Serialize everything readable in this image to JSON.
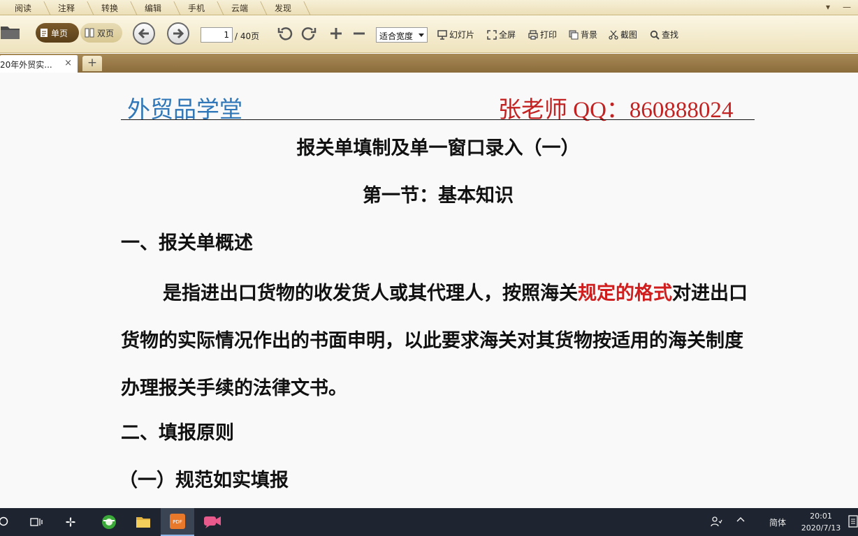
{
  "menu": {
    "tabs": [
      "阅读",
      "注释",
      "转换",
      "编辑",
      "手机",
      "云端",
      "发现"
    ]
  },
  "toolbar": {
    "single_page": "单页",
    "double_page": "双页",
    "current_page": "1",
    "total_pages": "/ 40页",
    "zoom_mode": "适合宽度",
    "slideshow": "幻灯片",
    "fullscreen": "全屏",
    "print": "打印",
    "background": "背景",
    "screenshot": "截图",
    "find": "查找"
  },
  "tabs": {
    "doc_tab": "20年外贸实...",
    "close": "×",
    "new_tab": "+"
  },
  "document": {
    "header_left": "外贸品学堂",
    "header_right": "张老师 QQ：860888024",
    "title": "报关单填制及单一窗口录入（一）",
    "subtitle": "第一节：基本知识",
    "section1": "一、报关单概述",
    "para_part1": "是指进出口货物的收发货人或其代理人，按照海关",
    "para_highlight": "规定的格式",
    "para_part2": "对进出口货物的实际情况作出的书面申明，以此要求海关对其货物按适用的海关制度办理报关手续的法律文书。",
    "section2": "二、填报原则",
    "subsection1": "（一）规范如实填报"
  },
  "taskbar": {
    "ime": "简体",
    "time": "20:01",
    "date": "2020/7/13"
  },
  "colors": {
    "header_left": "#2f77b8",
    "header_right": "#c22222",
    "highlight": "#d01e1e"
  }
}
